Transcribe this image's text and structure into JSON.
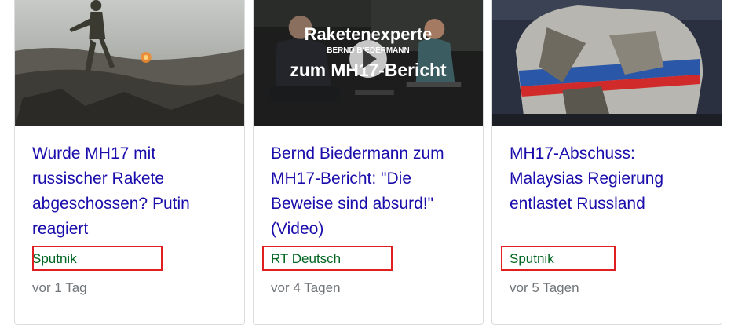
{
  "cards": [
    {
      "headline": "Wurde MH17 mit russischer Rakete abgeschossen? Putin reagiert",
      "source": "Sputnik",
      "time": "vor 1 Tag"
    },
    {
      "headline": "Bernd Biedermann zum MH17-Bericht: \"Die Beweise sind absurd!\" (Video)",
      "source": "RT Deutsch",
      "time": "vor 4 Tagen",
      "video_overlay": {
        "line1": "Raketenexperte",
        "line2": "BERND BIEDERMANN",
        "line3": "zum MH17-Bericht"
      }
    },
    {
      "headline": "MH17-Abschuss: Malaysias Regierung entlastet Russland",
      "source": "Sputnik",
      "time": "vor 5 Tagen"
    }
  ],
  "colors": {
    "headline": "#1a0dab",
    "source": "#006621",
    "time": "#70757a",
    "highlight_box": "#e02020"
  }
}
